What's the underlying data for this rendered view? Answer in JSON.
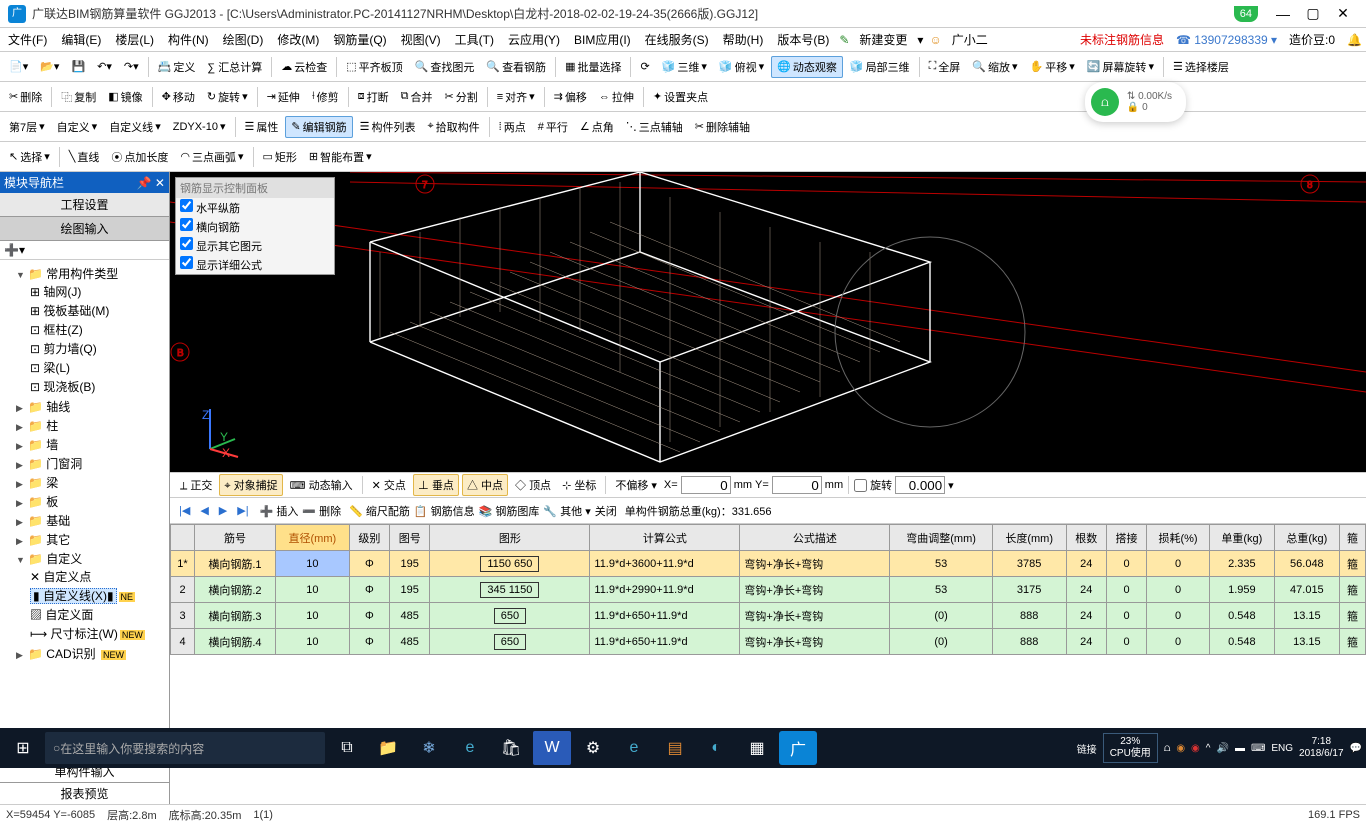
{
  "title": "广联达BIM钢筋算量软件 GGJ2013 - [C:\\Users\\Administrator.PC-20141127NRHM\\Desktop\\白龙村-2018-02-02-19-24-35(2666版).GGJ12]",
  "version_badge": "64",
  "menu": [
    "文件(F)",
    "编辑(E)",
    "楼层(L)",
    "构件(N)",
    "绘图(D)",
    "修改(M)",
    "钢筋量(Q)",
    "视图(V)",
    "工具(T)",
    "云应用(Y)",
    "BIM应用(I)",
    "在线服务(S)",
    "帮助(H)",
    "版本号(B)"
  ],
  "menu_right": {
    "new_change": "新建变更",
    "user": "广小二",
    "warn": "未标注钢筋信息",
    "phone": "13907298339",
    "credit": "造价豆:0"
  },
  "toolbar1": [
    "定义",
    "∑ 汇总计算",
    "云检查",
    "平齐板顶",
    "查找图元",
    "查看钢筋",
    "批量选择",
    "三维",
    "俯视",
    "动态观察",
    "局部三维",
    "全屏",
    "缩放",
    "平移",
    "屏幕旋转",
    "选择楼层"
  ],
  "toolbar2": [
    "删除",
    "复制",
    "镜像",
    "移动",
    "旋转",
    "延伸",
    "修剪",
    "打断",
    "合并",
    "分割",
    "对齐",
    "偏移",
    "拉伸",
    "设置夹点"
  ],
  "toolbar3": {
    "floor": "第7层",
    "cat": "自定义",
    "line": "自定义线",
    "code": "ZDYX-10",
    "items": [
      "属性",
      "编辑钢筋",
      "构件列表",
      "拾取构件",
      "两点",
      "平行",
      "点角",
      "三点辅轴",
      "删除辅轴"
    ]
  },
  "toolbar4": [
    "选择",
    "直线",
    "点加长度",
    "三点画弧",
    "矩形",
    "智能布置"
  ],
  "leftpane": {
    "title": "模块导航栏",
    "tabs": [
      "工程设置",
      "绘图输入"
    ],
    "tree_root": "常用构件类型",
    "tree_common": [
      "轴网(J)",
      "筏板基础(M)",
      "框柱(Z)",
      "剪力墙(Q)",
      "梁(L)",
      "现浇板(B)"
    ],
    "tree_cat": [
      "轴线",
      "柱",
      "墙",
      "门窗洞",
      "梁",
      "板",
      "基础",
      "其它"
    ],
    "custom": "自定义",
    "custom_items": [
      "自定义点",
      "自定义线(X)",
      "自定义面",
      "尺寸标注(W)"
    ],
    "cad": "CAD识别",
    "bottom_tabs": [
      "单构件输入",
      "报表预览"
    ]
  },
  "control_panel": {
    "title": "钢筋显示控制面板",
    "items": [
      "水平纵筋",
      "横向钢筋",
      "显示其它图元",
      "显示详细公式"
    ]
  },
  "snapbar": {
    "items": [
      "正交",
      "对象捕捉",
      "动态输入",
      "交点",
      "垂点",
      "中点",
      "顶点",
      "坐标",
      "不偏移"
    ],
    "x_label": "X=",
    "x": "0",
    "y_label": "Y=",
    "y": "0",
    "unit": "mm",
    "rotate": "旋转",
    "rotate_val": "0.000"
  },
  "tablebar": {
    "items": [
      "插入",
      "删除",
      "缩尺配筋",
      "钢筋信息",
      "钢筋图库",
      "其他",
      "关闭"
    ],
    "total_label": "单构件钢筋总重(kg)：",
    "total": "331.656"
  },
  "grid": {
    "headers": [
      "",
      "筋号",
      "直径(mm)",
      "级别",
      "图号",
      "图形",
      "计算公式",
      "公式描述",
      "弯曲调整(mm)",
      "长度(mm)",
      "根数",
      "搭接",
      "损耗(%)",
      "单重(kg)",
      "总重(kg)",
      "箍"
    ],
    "rows": [
      {
        "n": "1*",
        "name": "横向钢筋.1",
        "dia": "10",
        "lvl": "Φ",
        "fig": "195",
        "shape": "1150 650",
        "formula": "11.9*d+3600+11.9*d",
        "desc": "弯钩+净长+弯钩",
        "adj": "53",
        "len": "3785",
        "cnt": "24",
        "lap": "0",
        "loss": "0",
        "uw": "2.335",
        "tw": "56.048",
        "g": "箍"
      },
      {
        "n": "2",
        "name": "横向钢筋.2",
        "dia": "10",
        "lvl": "Φ",
        "fig": "195",
        "shape": "345 1150",
        "formula": "11.9*d+2990+11.9*d",
        "desc": "弯钩+净长+弯钩",
        "adj": "53",
        "len": "3175",
        "cnt": "24",
        "lap": "0",
        "loss": "0",
        "uw": "1.959",
        "tw": "47.015",
        "g": "箍"
      },
      {
        "n": "3",
        "name": "横向钢筋.3",
        "dia": "10",
        "lvl": "Φ",
        "fig": "485",
        "shape": "650",
        "formula": "11.9*d+650+11.9*d",
        "desc": "弯钩+净长+弯钩",
        "adj": "(0)",
        "len": "888",
        "cnt": "24",
        "lap": "0",
        "loss": "0",
        "uw": "0.548",
        "tw": "13.15",
        "g": "箍"
      },
      {
        "n": "4",
        "name": "横向钢筋.4",
        "dia": "10",
        "lvl": "Φ",
        "fig": "485",
        "shape": "650",
        "formula": "11.9*d+650+11.9*d",
        "desc": "弯钩+净长+弯钩",
        "adj": "(0)",
        "len": "888",
        "cnt": "24",
        "lap": "0",
        "loss": "0",
        "uw": "0.548",
        "tw": "13.15",
        "g": "箍"
      }
    ]
  },
  "status": {
    "coord": "X=59454 Y=-6085",
    "floor_h": "层高:2.8m",
    "base": "底标高:20.35m",
    "sel": "1(1)",
    "fps": "169.1 FPS"
  },
  "netstatus": {
    "speed": "0.00K/s",
    "conn": "0"
  },
  "taskbar": {
    "search_placeholder": "在这里输入你要搜索的内容",
    "link": "链接",
    "cpu_pct": "23%",
    "cpu_lbl": "CPU使用",
    "lang": "ENG",
    "time": "7:18",
    "date": "2018/6/17"
  }
}
